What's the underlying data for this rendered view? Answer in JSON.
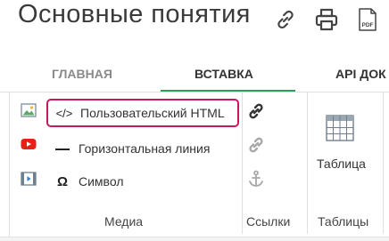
{
  "header": {
    "title": "Основные понятия",
    "icons": [
      "link-icon",
      "print-icon",
      "pdf-icon"
    ],
    "pdf_icon_text": "PDF"
  },
  "tabs": [
    {
      "label": "ГЛАВНАЯ",
      "active": false
    },
    {
      "label": "ВСТАВКА",
      "active": true
    },
    {
      "label": "API ДОК",
      "active": false
    }
  ],
  "ribbon": {
    "media": {
      "icons": [
        "image-icon",
        "youtube-icon",
        "video-icon"
      ],
      "items": [
        {
          "icon": "code-icon",
          "glyph": "</>",
          "label": "Пользовательский HTML",
          "highlighted": true
        },
        {
          "icon": "horizontal-line-icon",
          "glyph": "—",
          "label": "Горизонтальная линия",
          "highlighted": false
        },
        {
          "icon": "omega-icon",
          "glyph": "Ω",
          "label": "Символ",
          "highlighted": false
        }
      ],
      "group_label": "Медиа"
    },
    "links": {
      "icons": [
        "link-chain-icon",
        "unlink-chain-icon",
        "anchor-icon"
      ],
      "group_label": "Ссылки"
    },
    "tables": {
      "button_label": "Таблица",
      "group_label": "Таблицы"
    }
  },
  "colors": {
    "active_tab_underline": "#2e9f5a",
    "highlight_border": "#c8175d",
    "youtube_red": "#e62117"
  }
}
